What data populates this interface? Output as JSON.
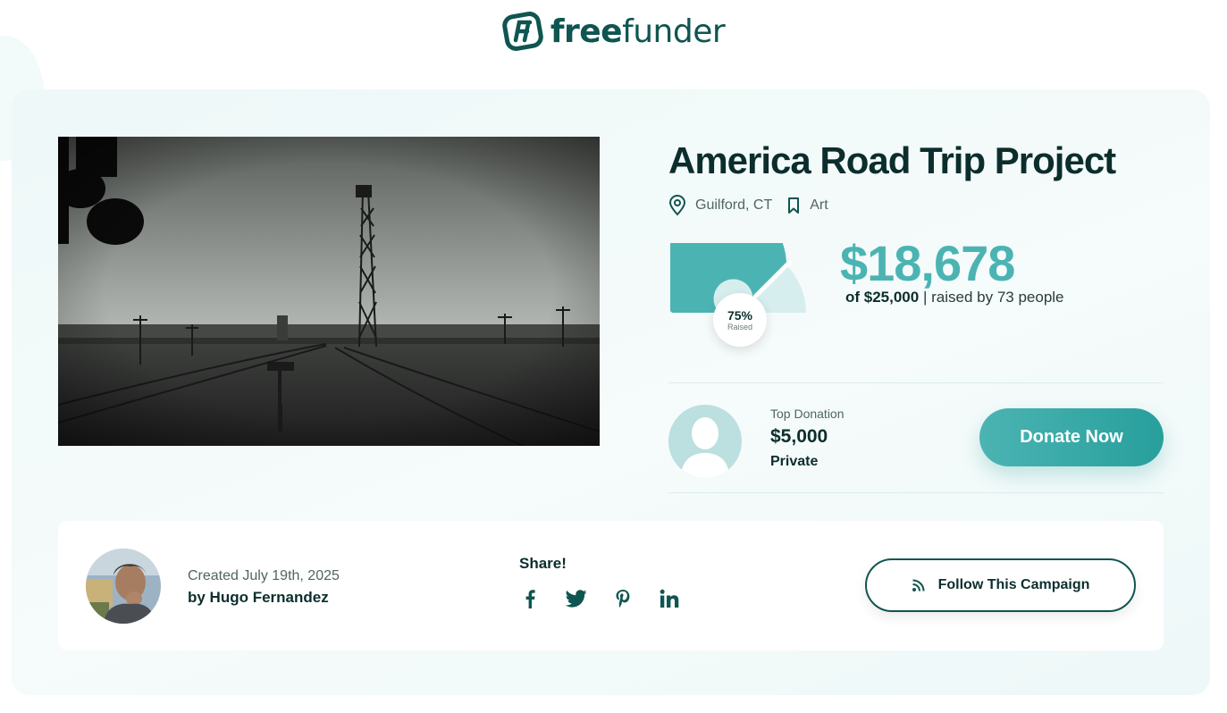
{
  "brand": {
    "name_bold": "free",
    "name_regular": "funder"
  },
  "campaign": {
    "title": "America Road Trip Project",
    "location": "Guilford, CT",
    "category": "Art",
    "raised_amount": "$18,678",
    "goal_amount": "of $25,000",
    "goal_separator": "|",
    "supporters": "raised by 73 people",
    "progress_percent": 75,
    "progress_label": "75%",
    "progress_caption": "Raised"
  },
  "top_donation": {
    "label": "Top Donation",
    "amount": "$5,000",
    "donor": "Private"
  },
  "actions": {
    "donate_label": "Donate Now",
    "follow_label": "Follow This Campaign"
  },
  "creator": {
    "created": "Created July 19th, 2025",
    "by": "by Hugo Fernandez"
  },
  "share": {
    "label": "Share!",
    "networks": [
      "facebook-icon",
      "twitter-icon",
      "pinterest-icon",
      "linkedin-icon"
    ]
  },
  "colors": {
    "brand_dark": "#0f5551",
    "accent": "#4bb4b3",
    "gauge_track": "#d7eeee"
  }
}
